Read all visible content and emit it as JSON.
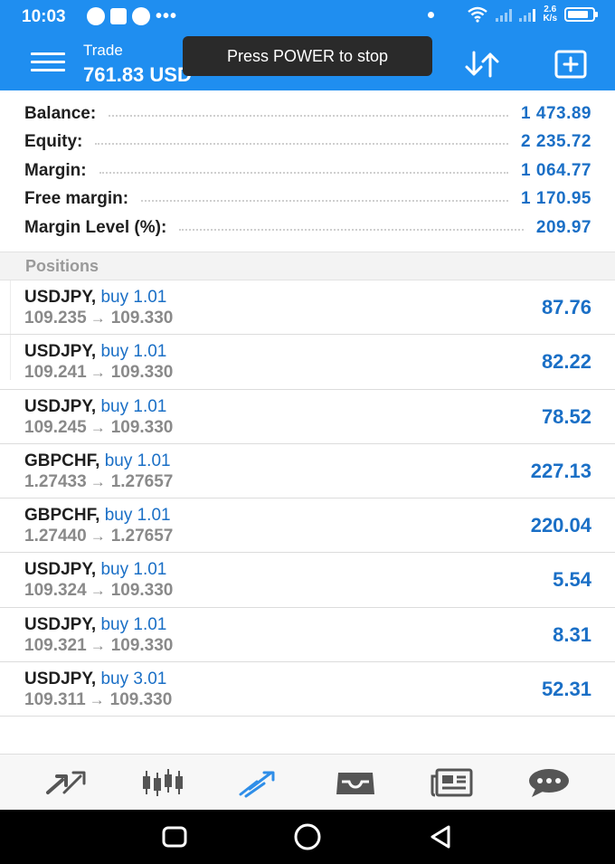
{
  "status_bar": {
    "time": "10:03",
    "net_speed_value": "2.6",
    "net_speed_unit": "K/s"
  },
  "header": {
    "title": "Trade",
    "value": "761.83 USD",
    "toast": "Press POWER to stop"
  },
  "summary": [
    {
      "label": "Balance:",
      "value": "1 473.89"
    },
    {
      "label": "Equity:",
      "value": "2 235.72"
    },
    {
      "label": "Margin:",
      "value": "1 064.77"
    },
    {
      "label": "Free margin:",
      "value": "1 170.95"
    },
    {
      "label": "Margin Level (%):",
      "value": "209.97"
    }
  ],
  "positions_header": "Positions",
  "positions": [
    {
      "symbol": "USDJPY,",
      "type": "buy 1.01",
      "open": "109.235",
      "arrow": "→",
      "current": "109.330",
      "profit": "87.76"
    },
    {
      "symbol": "USDJPY,",
      "type": "buy 1.01",
      "open": "109.241",
      "arrow": "→",
      "current": "109.330",
      "profit": "82.22"
    },
    {
      "symbol": "USDJPY,",
      "type": "buy 1.01",
      "open": "109.245",
      "arrow": "→",
      "current": "109.330",
      "profit": "78.52"
    },
    {
      "symbol": "GBPCHF,",
      "type": "buy 1.01",
      "open": "1.27433",
      "arrow": "→",
      "current": "1.27657",
      "profit": "227.13"
    },
    {
      "symbol": "GBPCHF,",
      "type": "buy 1.01",
      "open": "1.27440",
      "arrow": "→",
      "current": "1.27657",
      "profit": "220.04"
    },
    {
      "symbol": "USDJPY,",
      "type": "buy 1.01",
      "open": "109.324",
      "arrow": "→",
      "current": "109.330",
      "profit": "5.54"
    },
    {
      "symbol": "USDJPY,",
      "type": "buy 1.01",
      "open": "109.321",
      "arrow": "→",
      "current": "109.330",
      "profit": "8.31"
    },
    {
      "symbol": "USDJPY,",
      "type": "buy 3.01",
      "open": "109.311",
      "arrow": "→",
      "current": "109.330",
      "profit": "52.31"
    }
  ],
  "bottom_nav": [
    {
      "icon": "quotes-icon",
      "active": false
    },
    {
      "icon": "chart-icon",
      "active": false
    },
    {
      "icon": "trade-icon",
      "active": true
    },
    {
      "icon": "history-icon",
      "active": false
    },
    {
      "icon": "news-icon",
      "active": false
    },
    {
      "icon": "messages-icon",
      "active": false
    }
  ],
  "colors": {
    "header_blue": "#1f8ef0",
    "value_blue": "#1a6fc6",
    "icon_gray": "#555555"
  }
}
